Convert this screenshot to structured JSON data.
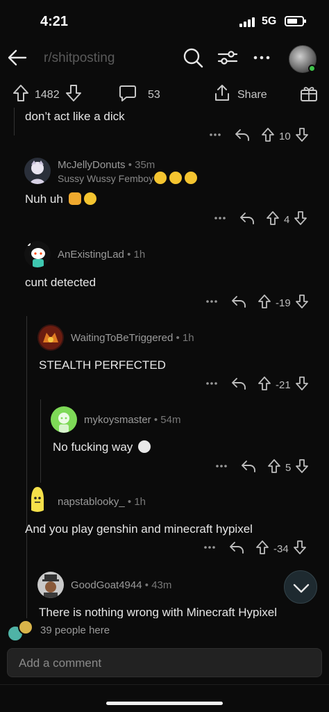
{
  "status_bar": {
    "time": "4:21",
    "network": "5G"
  },
  "nav": {
    "subreddit": "r/shitposting"
  },
  "post_actions": {
    "upvotes": "1482",
    "comments": "53",
    "share_label": "Share"
  },
  "comments": [
    {
      "author": "",
      "body": "don’t act like a dick",
      "votes": "10"
    },
    {
      "author": "McJellyDonuts",
      "time": "35m",
      "flair": "Sussy Wussy Femboy",
      "body": "Nuh uh",
      "votes": "4"
    },
    {
      "author": "AnExistingLad",
      "time": "1h",
      "body": "cunt detected",
      "votes": "-19"
    },
    {
      "author": "WaitingToBeTriggered",
      "time": "1h",
      "body": "STEALTH PERFECTED",
      "votes": "-21"
    },
    {
      "author": "mykoysmaster",
      "time": "54m",
      "body": "No fucking way",
      "votes": "5"
    },
    {
      "author": "napstablooky_",
      "time": "1h",
      "body": "And you play genshin and minecraft hypixel",
      "votes": "-34"
    },
    {
      "author": "GoodGoat4944",
      "time": "43m",
      "body": "There is nothing wrong with Minecraft Hypixel"
    }
  ],
  "presence": {
    "text": "39 people here"
  },
  "composer": {
    "placeholder": "Add a comment"
  },
  "colors": {
    "background": "#0b0b0b",
    "online": "#3ec44a",
    "muted": "#9a9a9a"
  }
}
